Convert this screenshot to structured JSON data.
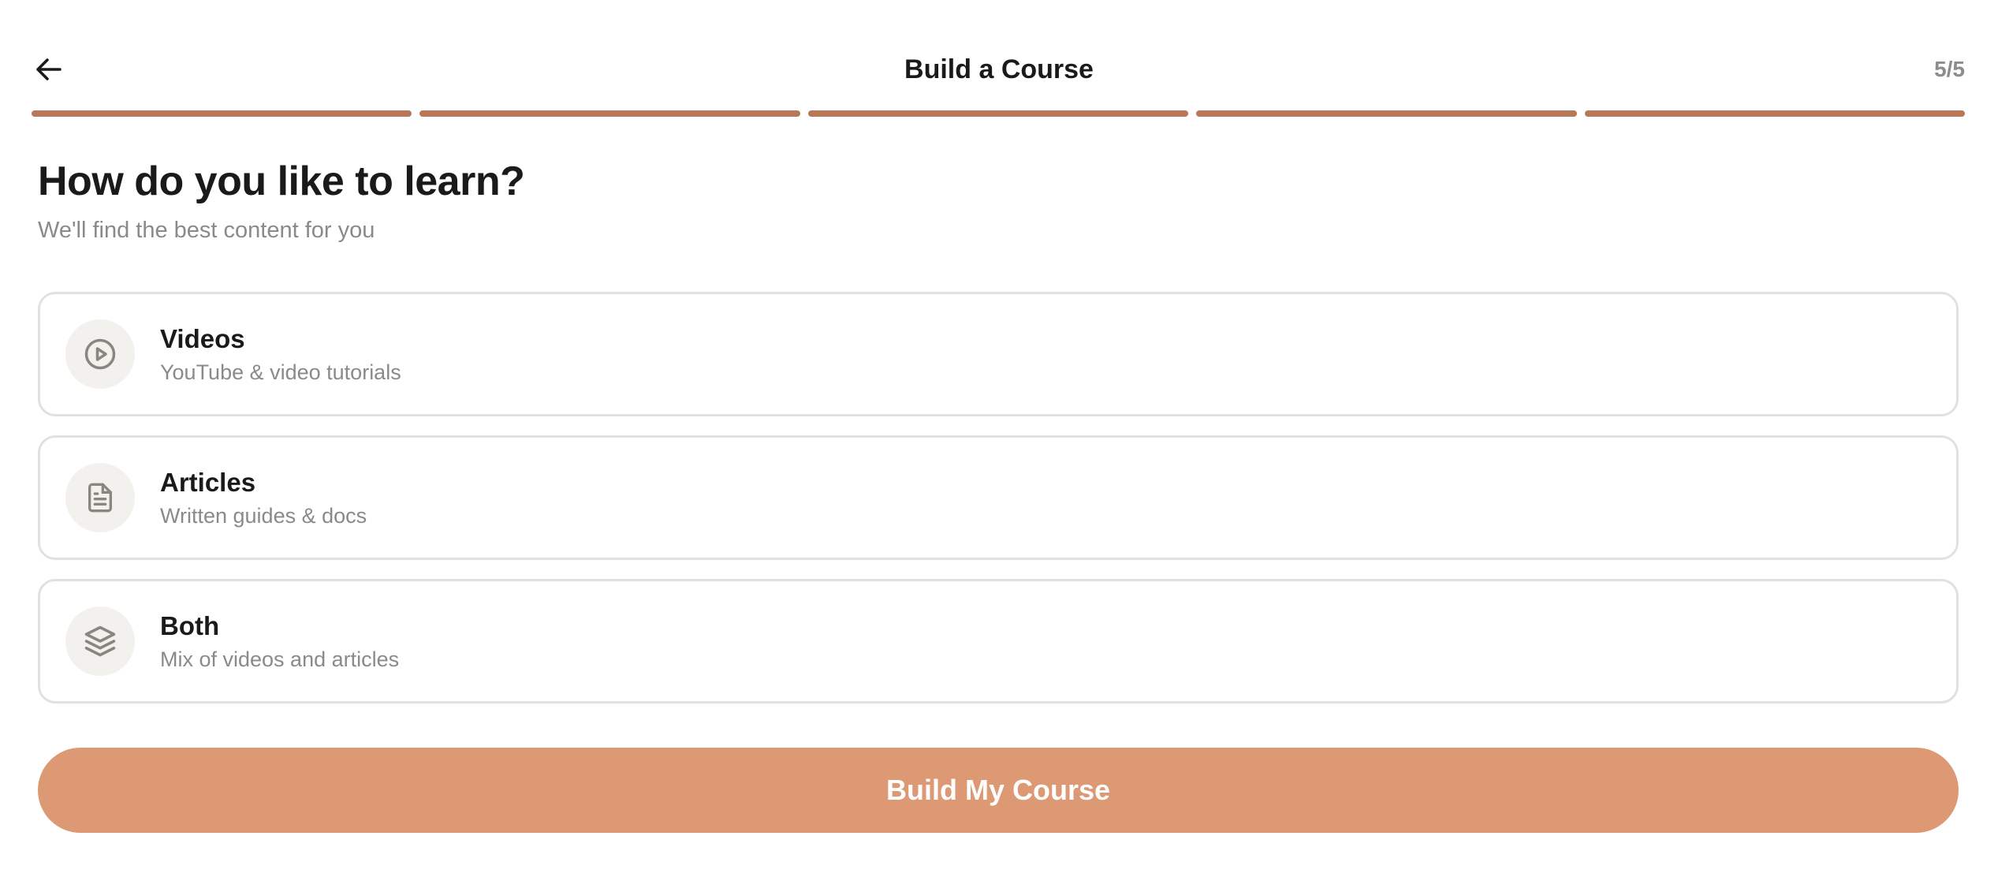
{
  "header": {
    "title": "Build a Course",
    "step_counter": "5/5",
    "back_icon": "arrow-left-icon"
  },
  "progress": {
    "total_steps": 5,
    "completed_steps": 5,
    "active_color": "#b8785a"
  },
  "question": {
    "title": "How do you like to learn?",
    "subtitle": "We'll find the best content for you"
  },
  "options": [
    {
      "title": "Videos",
      "description": "YouTube & video tutorials",
      "icon": "play-circle-icon"
    },
    {
      "title": "Articles",
      "description": "Written guides & docs",
      "icon": "document-icon"
    },
    {
      "title": "Both",
      "description": "Mix of videos and articles",
      "icon": "layers-icon"
    }
  ],
  "cta": {
    "label": "Build My Course",
    "color": "#dd9874"
  }
}
